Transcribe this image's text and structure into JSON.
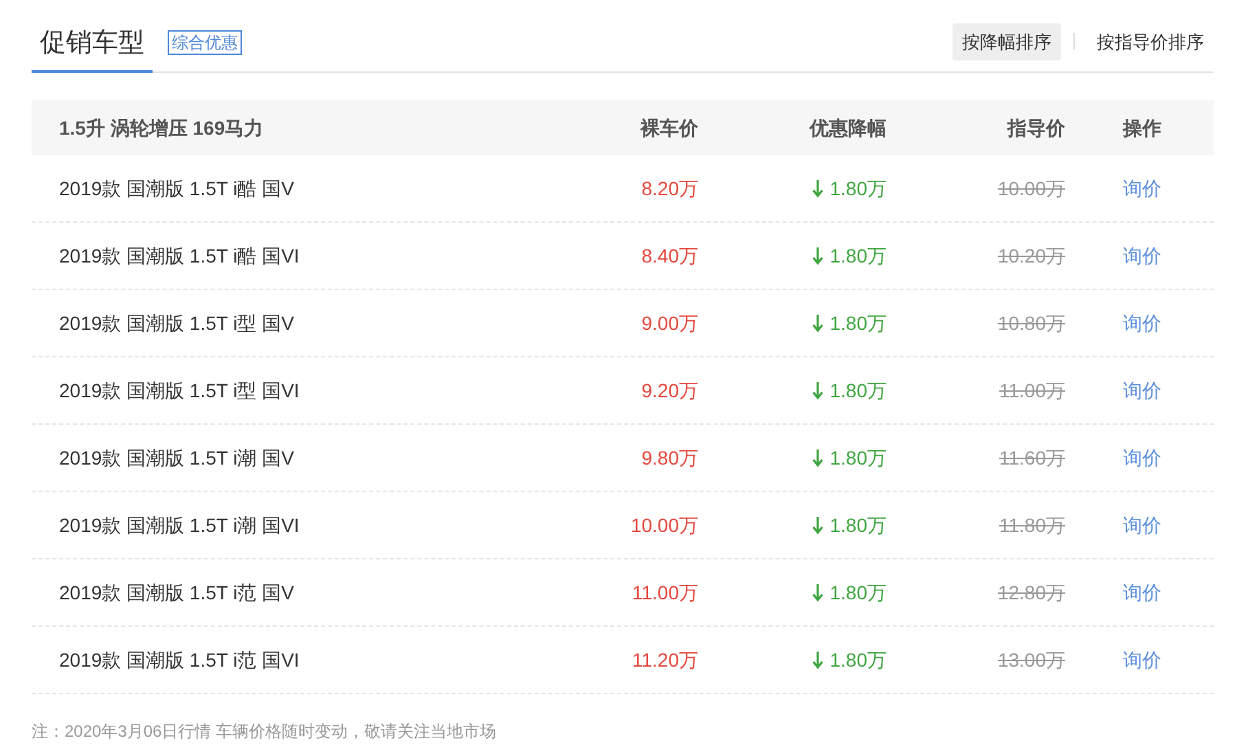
{
  "tab": {
    "label": "促销车型",
    "selected": true
  },
  "badge": "综合优惠",
  "sort_buttons": [
    {
      "label": "按降幅排序",
      "selected": true
    },
    {
      "label": "按指导价排序",
      "selected": false
    }
  ],
  "table": {
    "columns": [
      "1.5升 涡轮增压 169马力",
      "裸车价",
      "优惠降幅",
      "指导价",
      "操作"
    ],
    "rows": [
      {
        "name": "2019款 国潮版 1.5T i酷 国V",
        "price": "8.20万",
        "drop": "1.80万",
        "guide_price": "10.00万",
        "action": "询价"
      },
      {
        "name": "2019款 国潮版 1.5T i酷 国VI",
        "price": "8.40万",
        "drop": "1.80万",
        "guide_price": "10.20万",
        "action": "询价"
      },
      {
        "name": "2019款 国潮版 1.5T i型 国V",
        "price": "9.00万",
        "drop": "1.80万",
        "guide_price": "10.80万",
        "action": "询价"
      },
      {
        "name": "2019款 国潮版 1.5T i型 国VI",
        "price": "9.20万",
        "drop": "1.80万",
        "guide_price": "11.00万",
        "action": "询价"
      },
      {
        "name": "2019款 国潮版 1.5T i潮 国V",
        "price": "9.80万",
        "drop": "1.80万",
        "guide_price": "11.60万",
        "action": "询价"
      },
      {
        "name": "2019款 国潮版 1.5T i潮 国VI",
        "price": "10.00万",
        "drop": "1.80万",
        "guide_price": "11.80万",
        "action": "询价"
      },
      {
        "name": "2019款 国潮版 1.5T i范 国V",
        "price": "11.00万",
        "drop": "1.80万",
        "guide_price": "12.80万",
        "action": "询价"
      },
      {
        "name": "2019款 国潮版 1.5T i范 国VI",
        "price": "11.20万",
        "drop": "1.80万",
        "guide_price": "13.00万",
        "action": "询价"
      }
    ]
  },
  "note": "注：2020年3月06日行情 车辆价格随时变动，敬请关注当地市场"
}
